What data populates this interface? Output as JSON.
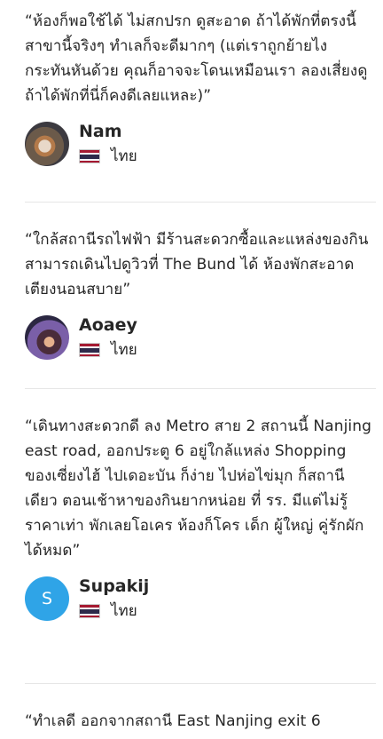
{
  "reviews": [
    {
      "text": "“ห้องก็พอใช้ได้ ไม่สกปรก ดูสะอาด ถ้าได้พักที่ตรงนี้ สาขานี้จริงๆ ทำเลก็จะดีมากๆ (แต่เราถูกย้ายไง กระทันหันด้วย คุณก็อาจจะโดนเหมือนเรา ลองเสี่ยงดู ถ้าได้พักที่นี่ก็คงดีเลยแหละ)”",
      "name": "Nam",
      "country": "ไทย"
    },
    {
      "text": "“ใกล้สถานีรถไฟฟ้า มีร้านสะดวกซื้อและแหล่งของกิน สามารถเดินไปดูวิวที่ The Bund ได้ ห้องพักสะอาด เตียงนอนสบาย”",
      "name": "Aoaey",
      "country": "ไทย"
    },
    {
      "text": "“เดินทางสะดวกดี ลง Metro สาย 2 สถานนี้ Nanjing east road, ออกประตู 6 อยู่ใกล้แหล่ง Shopping ของเซี่ยงไฮ้ ไปเดอะบัน ก็ง่าย ไปห่อไข่มุก ก็สถานีเดียว ตอนเช้าหาของกินยากหน่อย ที่ รร. มีแต่ไม่รู้ราคาเท่า พักเลยโอเคร ห้องก็โคร เด็ก ผู้ใหญ่ คู่รักผักได้หมด”",
      "name": "Supakij",
      "avatar_letter": "S",
      "country": "ไทย"
    },
    {
      "text": "“ทำเลดี ออกจากสถานี East Nanjing exit 6"
    }
  ],
  "flag_colors": [
    "#a51931",
    "#f4f5f8",
    "#2d2a4a",
    "#f4f5f8",
    "#a51931"
  ],
  "avatar_color": "#2fa4e7"
}
